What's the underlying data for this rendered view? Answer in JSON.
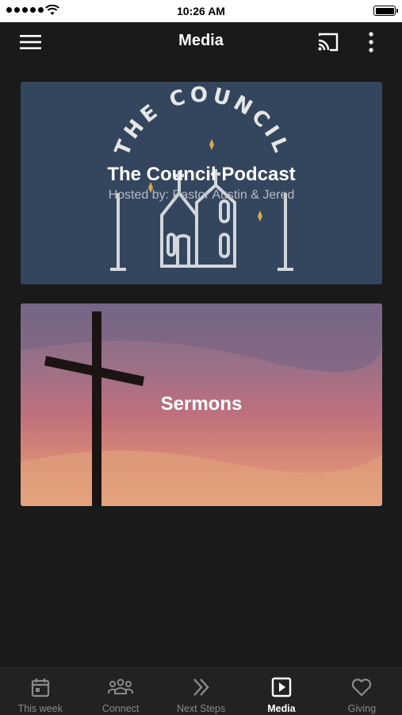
{
  "status_bar": {
    "time": "10:26 AM"
  },
  "app_bar": {
    "title": "Media"
  },
  "cards": [
    {
      "title": "The Council Podcast",
      "subtitle": "Hosted by: Pastor Austin & Jered",
      "art_text": "THE COUNCIL"
    },
    {
      "title": "Sermons"
    }
  ],
  "tabs": [
    {
      "label": "This week",
      "icon": "calendar-icon",
      "active": false
    },
    {
      "label": "Connect",
      "icon": "group-icon",
      "active": false
    },
    {
      "label": "Next Steps",
      "icon": "double-chevron-icon",
      "active": false
    },
    {
      "label": "Media",
      "icon": "play-box-icon",
      "active": true
    },
    {
      "label": "Giving",
      "icon": "heart-icon",
      "active": false
    }
  ],
  "colors": {
    "background": "#1a1a1a",
    "podcast_card": "#34455e",
    "tab_active": "#ffffff",
    "tab_inactive": "#8a8a8a",
    "accent_gold": "#d9a84a"
  }
}
